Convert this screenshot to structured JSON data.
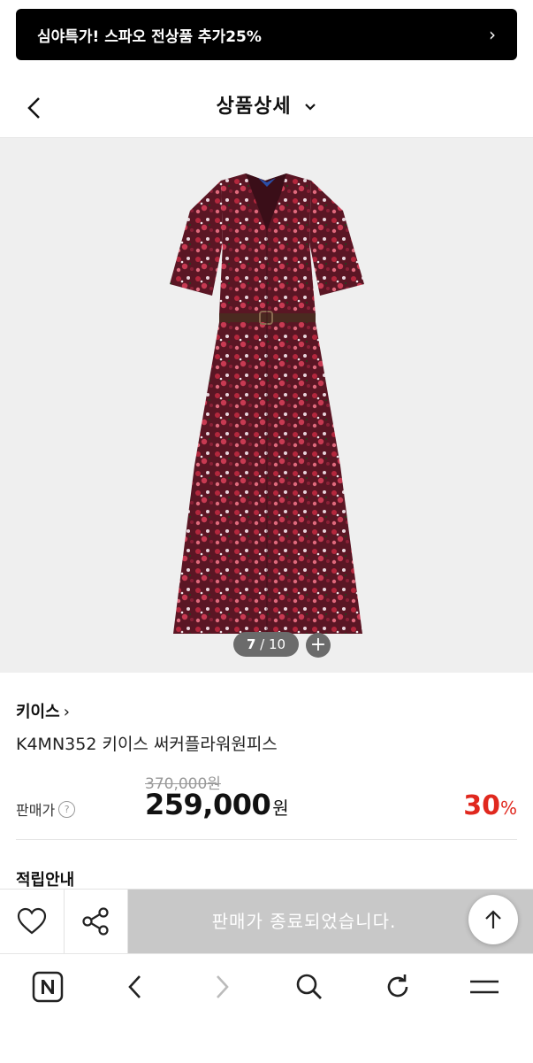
{
  "promo": {
    "text": "심야특가! 스파오 전상품 추가25%",
    "chevron": "›"
  },
  "header": {
    "title": "상품상세"
  },
  "gallery": {
    "current": "7",
    "separator": " / ",
    "total": "10",
    "plus": "+"
  },
  "product": {
    "brand": "키이스",
    "brand_arrow": "›",
    "name": "K4MN352 키이스 써커플라워원피스",
    "original_price": "370,000원",
    "price_label": "판매가",
    "help_icon": "?",
    "price": "259,000",
    "price_unit": "원",
    "discount": "30",
    "discount_unit": "%"
  },
  "sections": {
    "reward_title": "적립안내"
  },
  "bottom_bar": {
    "soldout_text": "판매가 종료되었습니다."
  },
  "icons": {
    "back": "chevron-left-icon",
    "dropdown": "chevron-down-icon",
    "wish": "heart-icon",
    "share": "share-icon",
    "top": "arrow-up-icon",
    "nav": [
      "naver-home-icon",
      "back-arrow-icon",
      "forward-arrow-icon",
      "search-icon",
      "refresh-icon",
      "menu-icon"
    ]
  },
  "colors": {
    "accent_red": "#e0281e",
    "promo_bg": "#000000",
    "soldout_bg": "#c8c8c8",
    "dress": "#6e1f2e"
  }
}
